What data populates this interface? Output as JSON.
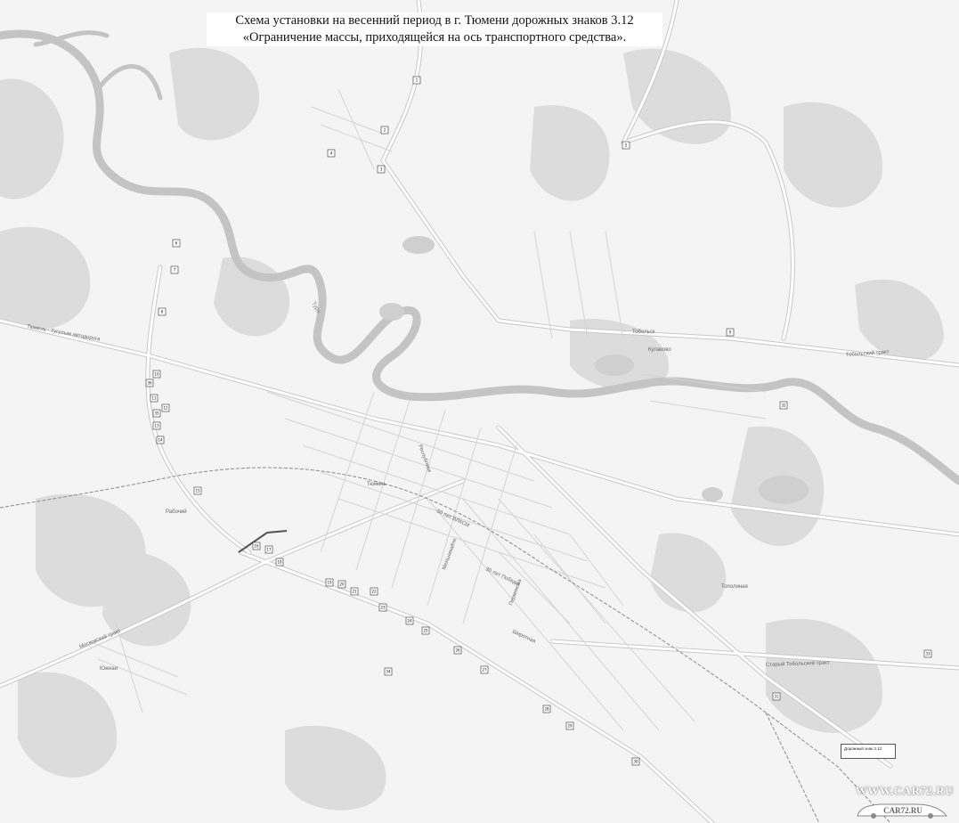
{
  "title": {
    "line1": "Схема установки на весенний период в г. Тюмени дорожных знаков 3.12",
    "line2": "«Ограничение массы, приходящейся на ось транспортного средства»."
  },
  "legend": {
    "text": "Дорожный знак 3.12"
  },
  "watermark": {
    "site_text": "WWW.CAR72.RU",
    "logo_text": "CAR72.RU"
  },
  "colors": {
    "background": "#f4f4f4",
    "green_area": "#d9d9d9",
    "water": "#c8c8c8",
    "road": "#ffffff",
    "road_casing": "#bdbdbd",
    "railway": "#8a8a8a",
    "sign_box": "#ffffff",
    "highlight_route": "#555555"
  },
  "signs": [
    {
      "n": "1"
    },
    {
      "n": "2"
    },
    {
      "n": "3"
    },
    {
      "n": "4"
    },
    {
      "n": "5"
    },
    {
      "n": "6"
    },
    {
      "n": "7"
    },
    {
      "n": "8"
    },
    {
      "n": "9"
    },
    {
      "n": "10"
    },
    {
      "n": "11"
    },
    {
      "n": "12"
    },
    {
      "n": "13"
    },
    {
      "n": "14"
    },
    {
      "n": "15"
    },
    {
      "n": "16"
    },
    {
      "n": "17"
    },
    {
      "n": "18"
    },
    {
      "n": "19"
    },
    {
      "n": "20"
    },
    {
      "n": "21"
    },
    {
      "n": "22"
    },
    {
      "n": "23"
    },
    {
      "n": "24"
    },
    {
      "n": "25"
    },
    {
      "n": "26"
    },
    {
      "n": "27"
    },
    {
      "n": "28"
    },
    {
      "n": "29"
    },
    {
      "n": "30"
    },
    {
      "n": "31"
    },
    {
      "n": "32"
    },
    {
      "n": "33"
    },
    {
      "n": "34"
    },
    {
      "n": "35"
    },
    {
      "n": "36"
    }
  ],
  "labels": {
    "tura": "Тура",
    "tobol_trakt": "Тобольский тракт",
    "moscow_trakt": "Московский тракт",
    "old_tobol_trakt": "Старый Тобольский тракт",
    "tyumen_tugulym": "Тюмень - Тугулым автодорога",
    "rabochiy": "Рабочий",
    "topolinaya": "Тополиная",
    "respubliki": "Республики",
    "melnikayte": "Мельникайте",
    "let50_vlksm": "50 лет ВЛКСМ",
    "let30_pobedy": "30 лет Победы",
    "shirotnaya": "Широтная",
    "permyakova": "Пермякова",
    "tyumen": "Тюмень",
    "kulakovo": "Кулаково",
    "yuzhnaya": "Южная",
    "tobolsk_road": "Тобольск"
  }
}
